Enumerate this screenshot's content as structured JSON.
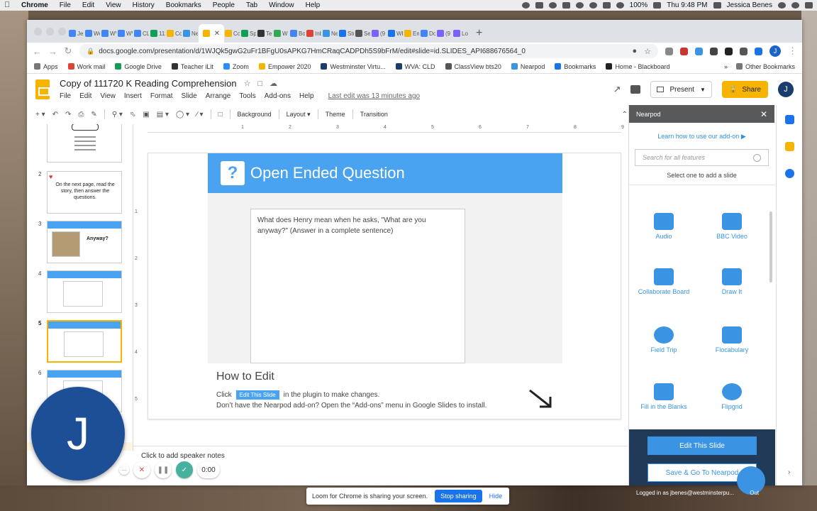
{
  "mac_menubar": {
    "app": "Chrome",
    "items": [
      "File",
      "Edit",
      "View",
      "History",
      "Bookmarks",
      "People",
      "Tab",
      "Window",
      "Help"
    ],
    "battery": "100%",
    "clock": "Thu 9:48 PM",
    "user": "Jessica Benes"
  },
  "browser": {
    "tabs": [
      {
        "label": "Jes",
        "color": "#4285f4"
      },
      {
        "label": "We",
        "color": "#4285f4"
      },
      {
        "label": "WV",
        "color": "#4285f4"
      },
      {
        "label": "WV",
        "color": "#4285f4"
      },
      {
        "label": "CLI",
        "color": "#4285f4"
      },
      {
        "label": "111",
        "color": "#0f9d58"
      },
      {
        "label": "Co",
        "color": "#f4b400"
      },
      {
        "label": "Ne",
        "color": "#3a93e3"
      },
      {
        "label": "Co",
        "color": "#f4b400"
      },
      {
        "label": "Sp",
        "color": "#0f9d58"
      },
      {
        "label": "Te",
        "color": "#333333"
      },
      {
        "label": "W",
        "color": "#34a853"
      },
      {
        "label": "Bo",
        "color": "#4285f4"
      },
      {
        "label": "Inb",
        "color": "#db4437"
      },
      {
        "label": "Ne",
        "color": "#3a93e3"
      },
      {
        "label": "Stu",
        "color": "#1a73e8"
      },
      {
        "label": "Se",
        "color": "#555555"
      },
      {
        "label": "(9",
        "color": "#7b61ff"
      },
      {
        "label": "WF",
        "color": "#1a73e8"
      },
      {
        "label": "Em",
        "color": "#f4b400"
      },
      {
        "label": "Do",
        "color": "#4285f4"
      },
      {
        "label": "(9",
        "color": "#7b61ff"
      },
      {
        "label": "Lo",
        "color": "#7b61ff"
      }
    ],
    "active_tab_color": "#f4b400",
    "url": "docs.google.com/presentation/d/1WJQk5gwG2uFr1BFgU0sAPKG7HmCRaqCADPDh5S9bFrM/edit#slide=id.SLIDES_API688676564_0",
    "profile_initial": "J",
    "bookmarks": [
      {
        "label": "Apps",
        "color": "#777777"
      },
      {
        "label": "Work mail",
        "color": "#db4437"
      },
      {
        "label": "Google Drive",
        "color": "#0f9d58"
      },
      {
        "label": "Teacher iLit",
        "color": "#333333"
      },
      {
        "label": "Zoom",
        "color": "#2d8cff"
      },
      {
        "label": "Empower 2020",
        "color": "#f4b400"
      },
      {
        "label": "Westminster Virtu...",
        "color": "#1a3d6e"
      },
      {
        "label": "WVA: CLD",
        "color": "#1a3d6e"
      },
      {
        "label": "ClassView bts20",
        "color": "#555555"
      },
      {
        "label": "Nearpod",
        "color": "#3a93e3"
      },
      {
        "label": "Bookmarks",
        "color": "#1a73e8"
      },
      {
        "label": "Home - Blackboard",
        "color": "#222222"
      }
    ],
    "other_bookmarks": "Other Bookmarks"
  },
  "slides": {
    "doc_title": "Copy of 111720 K Reading Comprehension",
    "menu": [
      "File",
      "Edit",
      "View",
      "Insert",
      "Format",
      "Slide",
      "Arrange",
      "Tools",
      "Add-ons",
      "Help"
    ],
    "last_edit": "Last edit was 13 minutes ago",
    "present_label": "Present",
    "share_label": "Share",
    "user_initial": "J",
    "toolbar": {
      "background": "Background",
      "layout": "Layout",
      "theme": "Theme",
      "transition": "Transition"
    },
    "thumbnails": [
      {
        "num": "",
        "kind": "text"
      },
      {
        "num": "2",
        "kind": "text"
      },
      {
        "num": "3",
        "kind": "nearpod"
      },
      {
        "num": "4",
        "kind": "nearpod"
      },
      {
        "num": "5",
        "kind": "nearpod",
        "selected": true
      },
      {
        "num": "6",
        "kind": "nearpod"
      }
    ],
    "thumb_texts": {
      "t2": "On the next page, read the story, then answer the questions.",
      "t3": "Anyway?"
    },
    "ruler_marks": [
      "1",
      "2",
      "3",
      "4",
      "5",
      "6",
      "7",
      "8",
      "9"
    ],
    "slide": {
      "heading": "Open Ended Question",
      "question": "What does Henry mean when he asks, \"What are you anyway?\"  (Answer in a complete sentence)",
      "howto_title": "How to Edit",
      "howto_click": "Click",
      "howto_pill": "Edit This Slide",
      "howto_line1_rest": "in the plugin to make changes.",
      "howto_line2": "Don’t have the Nearpod add-on? Open the “Add-ons” menu in Google Slides to install."
    },
    "speaker_notes": "Click to add speaker notes"
  },
  "nearpod": {
    "title": "Nearpod",
    "learn_link": "Learn how to use our add-on",
    "search_placeholder": "Search for all features",
    "select_hint": "Select one to add a slide",
    "features": [
      {
        "label": "Audio",
        "icon": "speaker-icon"
      },
      {
        "label": "BBC Video",
        "icon": "bbc-icon"
      },
      {
        "label": "Collaborate Board",
        "icon": "board-icon"
      },
      {
        "label": "Draw It",
        "icon": "pencil-icon"
      },
      {
        "label": "Field Trip",
        "icon": "hiker-icon"
      },
      {
        "label": "Flocabulary",
        "icon": "flocabulary-icon"
      },
      {
        "label": "Fill in the Blanks",
        "icon": "blanks-icon"
      },
      {
        "label": "Flipgrid",
        "icon": "plus-circle-icon"
      }
    ],
    "edit_button": "Edit This Slide",
    "save_button": "Save & Go To Nearpod",
    "logged_in": "Logged in as jbenes@westminsterpu...",
    "logout": "Out"
  },
  "loom": {
    "avatar_initial": "J",
    "timer": "0:00",
    "sharing_text": "Loom for Chrome is sharing your screen.",
    "stop_sharing": "Stop sharing",
    "hide": "Hide"
  }
}
